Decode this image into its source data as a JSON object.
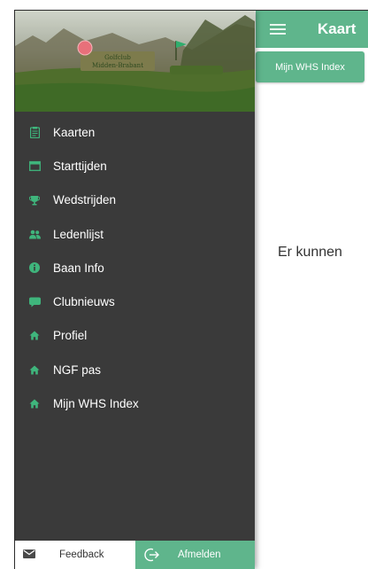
{
  "topbar": {
    "title": "Kaart",
    "menu_icon": "hamburger-icon"
  },
  "chip": {
    "label": "Mijn WHS Index"
  },
  "main": {
    "message": "Er kunnen"
  },
  "drawer": {
    "header": {
      "sign_text_line1": "Golfclub",
      "sign_text_line2": "Midden-Brabant"
    },
    "items": [
      {
        "label": "Kaarten",
        "icon": "scorecard-icon"
      },
      {
        "label": "Starttijden",
        "icon": "calendar-icon"
      },
      {
        "label": "Wedstrijden",
        "icon": "trophy-icon"
      },
      {
        "label": "Ledenlijst",
        "icon": "people-icon"
      },
      {
        "label": "Baan Info",
        "icon": "info-icon"
      },
      {
        "label": "Clubnieuws",
        "icon": "chat-icon"
      },
      {
        "label": "Profiel",
        "icon": "home-icon"
      },
      {
        "label": "NGF pas",
        "icon": "home-icon"
      },
      {
        "label": "Mijn WHS Index",
        "icon": "home-icon"
      }
    ],
    "footer": {
      "feedback_label": "Feedback",
      "logout_label": "Afmelden"
    }
  },
  "colors": {
    "accent": "#5fb58c",
    "drawer_bg": "#3a3a3a",
    "icon_green": "#3fb57c"
  }
}
